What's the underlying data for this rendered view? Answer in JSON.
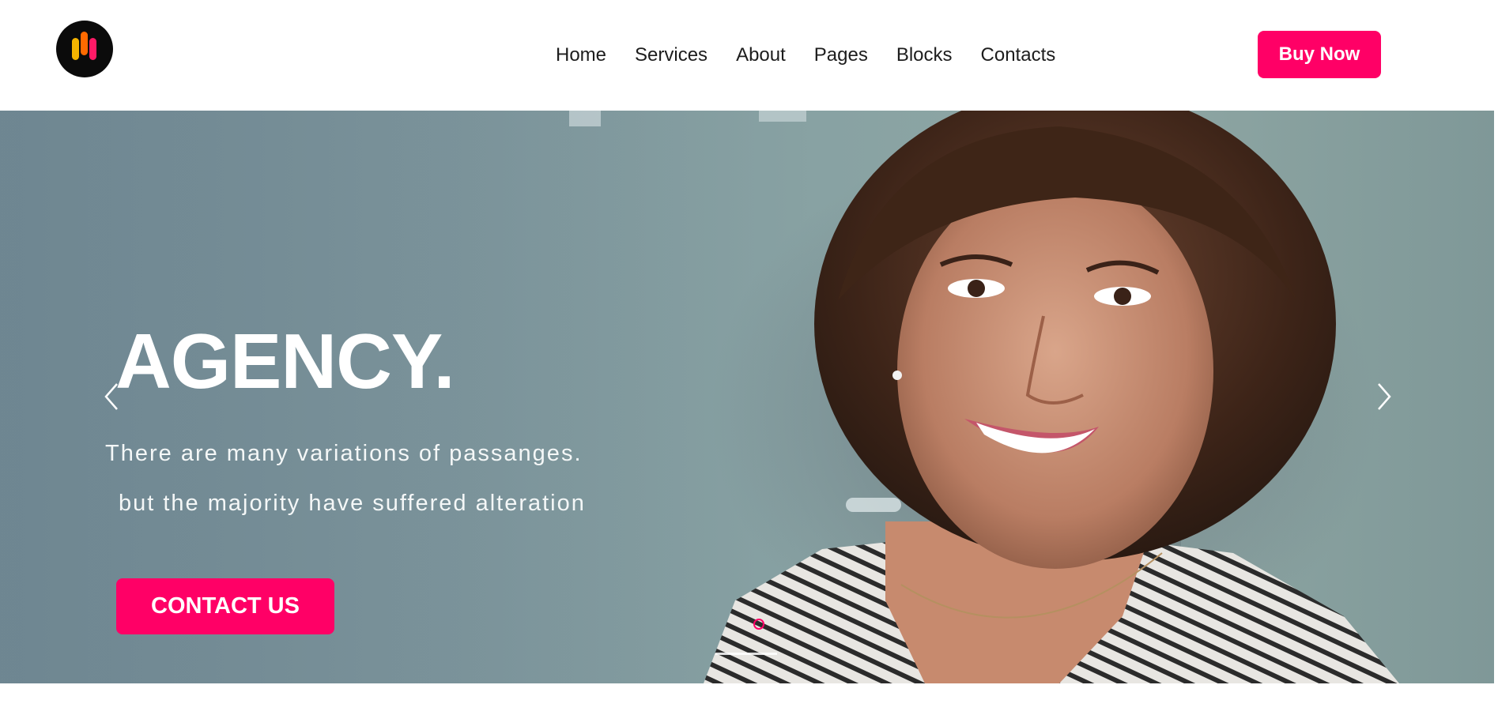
{
  "header": {
    "logo_icon": "bars-logo-icon",
    "nav": [
      "Home",
      "Services",
      "About",
      "Pages",
      "Blocks",
      "Contacts"
    ],
    "buy_label": "Buy Now"
  },
  "hero": {
    "title": "AGENCY.",
    "line1": "There are many variations of passanges.",
    "line2": "but the majority have suffered alteration",
    "cta_label": "CONTACT US",
    "prev_icon": "chevron-left-icon",
    "next_icon": "chevron-right-icon",
    "active_slide": 1
  },
  "colors": {
    "accent": "#ff0066",
    "logo_bg": "#0b0b0b",
    "logo_bar_yellow": "#f5b400",
    "logo_bar_orange": "#ff6a00",
    "logo_bar_pink": "#ff1a66"
  }
}
